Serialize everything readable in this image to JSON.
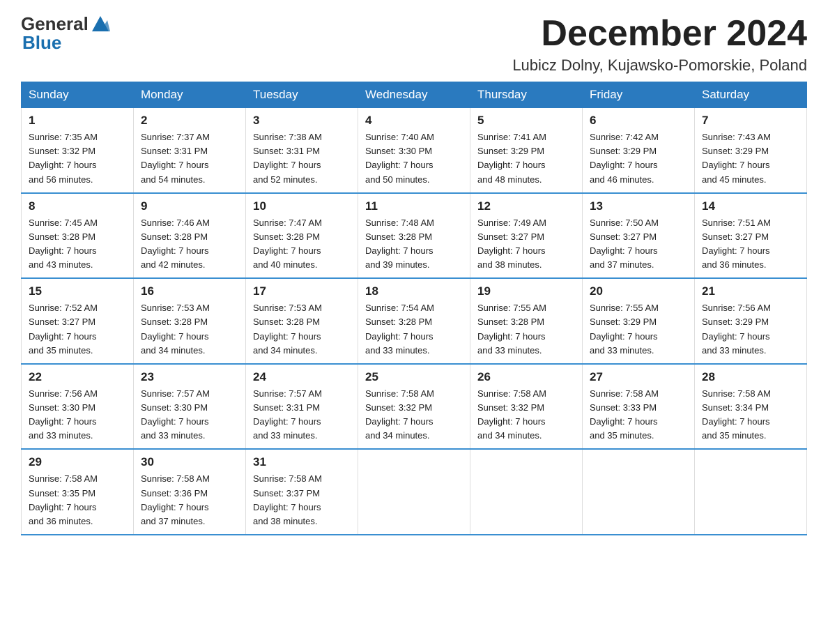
{
  "header": {
    "logo_general": "General",
    "logo_blue": "Blue",
    "month_title": "December 2024",
    "location": "Lubicz Dolny, Kujawsko-Pomorskie, Poland"
  },
  "days_of_week": [
    "Sunday",
    "Monday",
    "Tuesday",
    "Wednesday",
    "Thursday",
    "Friday",
    "Saturday"
  ],
  "weeks": [
    [
      {
        "day": "1",
        "sunrise": "7:35 AM",
        "sunset": "3:32 PM",
        "daylight": "7 hours and 56 minutes."
      },
      {
        "day": "2",
        "sunrise": "7:37 AM",
        "sunset": "3:31 PM",
        "daylight": "7 hours and 54 minutes."
      },
      {
        "day": "3",
        "sunrise": "7:38 AM",
        "sunset": "3:31 PM",
        "daylight": "7 hours and 52 minutes."
      },
      {
        "day": "4",
        "sunrise": "7:40 AM",
        "sunset": "3:30 PM",
        "daylight": "7 hours and 50 minutes."
      },
      {
        "day": "5",
        "sunrise": "7:41 AM",
        "sunset": "3:29 PM",
        "daylight": "7 hours and 48 minutes."
      },
      {
        "day": "6",
        "sunrise": "7:42 AM",
        "sunset": "3:29 PM",
        "daylight": "7 hours and 46 minutes."
      },
      {
        "day": "7",
        "sunrise": "7:43 AM",
        "sunset": "3:29 PM",
        "daylight": "7 hours and 45 minutes."
      }
    ],
    [
      {
        "day": "8",
        "sunrise": "7:45 AM",
        "sunset": "3:28 PM",
        "daylight": "7 hours and 43 minutes."
      },
      {
        "day": "9",
        "sunrise": "7:46 AM",
        "sunset": "3:28 PM",
        "daylight": "7 hours and 42 minutes."
      },
      {
        "day": "10",
        "sunrise": "7:47 AM",
        "sunset": "3:28 PM",
        "daylight": "7 hours and 40 minutes."
      },
      {
        "day": "11",
        "sunrise": "7:48 AM",
        "sunset": "3:28 PM",
        "daylight": "7 hours and 39 minutes."
      },
      {
        "day": "12",
        "sunrise": "7:49 AM",
        "sunset": "3:27 PM",
        "daylight": "7 hours and 38 minutes."
      },
      {
        "day": "13",
        "sunrise": "7:50 AM",
        "sunset": "3:27 PM",
        "daylight": "7 hours and 37 minutes."
      },
      {
        "day": "14",
        "sunrise": "7:51 AM",
        "sunset": "3:27 PM",
        "daylight": "7 hours and 36 minutes."
      }
    ],
    [
      {
        "day": "15",
        "sunrise": "7:52 AM",
        "sunset": "3:27 PM",
        "daylight": "7 hours and 35 minutes."
      },
      {
        "day": "16",
        "sunrise": "7:53 AM",
        "sunset": "3:28 PM",
        "daylight": "7 hours and 34 minutes."
      },
      {
        "day": "17",
        "sunrise": "7:53 AM",
        "sunset": "3:28 PM",
        "daylight": "7 hours and 34 minutes."
      },
      {
        "day": "18",
        "sunrise": "7:54 AM",
        "sunset": "3:28 PM",
        "daylight": "7 hours and 33 minutes."
      },
      {
        "day": "19",
        "sunrise": "7:55 AM",
        "sunset": "3:28 PM",
        "daylight": "7 hours and 33 minutes."
      },
      {
        "day": "20",
        "sunrise": "7:55 AM",
        "sunset": "3:29 PM",
        "daylight": "7 hours and 33 minutes."
      },
      {
        "day": "21",
        "sunrise": "7:56 AM",
        "sunset": "3:29 PM",
        "daylight": "7 hours and 33 minutes."
      }
    ],
    [
      {
        "day": "22",
        "sunrise": "7:56 AM",
        "sunset": "3:30 PM",
        "daylight": "7 hours and 33 minutes."
      },
      {
        "day": "23",
        "sunrise": "7:57 AM",
        "sunset": "3:30 PM",
        "daylight": "7 hours and 33 minutes."
      },
      {
        "day": "24",
        "sunrise": "7:57 AM",
        "sunset": "3:31 PM",
        "daylight": "7 hours and 33 minutes."
      },
      {
        "day": "25",
        "sunrise": "7:58 AM",
        "sunset": "3:32 PM",
        "daylight": "7 hours and 34 minutes."
      },
      {
        "day": "26",
        "sunrise": "7:58 AM",
        "sunset": "3:32 PM",
        "daylight": "7 hours and 34 minutes."
      },
      {
        "day": "27",
        "sunrise": "7:58 AM",
        "sunset": "3:33 PM",
        "daylight": "7 hours and 35 minutes."
      },
      {
        "day": "28",
        "sunrise": "7:58 AM",
        "sunset": "3:34 PM",
        "daylight": "7 hours and 35 minutes."
      }
    ],
    [
      {
        "day": "29",
        "sunrise": "7:58 AM",
        "sunset": "3:35 PM",
        "daylight": "7 hours and 36 minutes."
      },
      {
        "day": "30",
        "sunrise": "7:58 AM",
        "sunset": "3:36 PM",
        "daylight": "7 hours and 37 minutes."
      },
      {
        "day": "31",
        "sunrise": "7:58 AM",
        "sunset": "3:37 PM",
        "daylight": "7 hours and 38 minutes."
      },
      null,
      null,
      null,
      null
    ]
  ],
  "labels": {
    "sunrise": "Sunrise:",
    "sunset": "Sunset:",
    "daylight": "Daylight:"
  }
}
